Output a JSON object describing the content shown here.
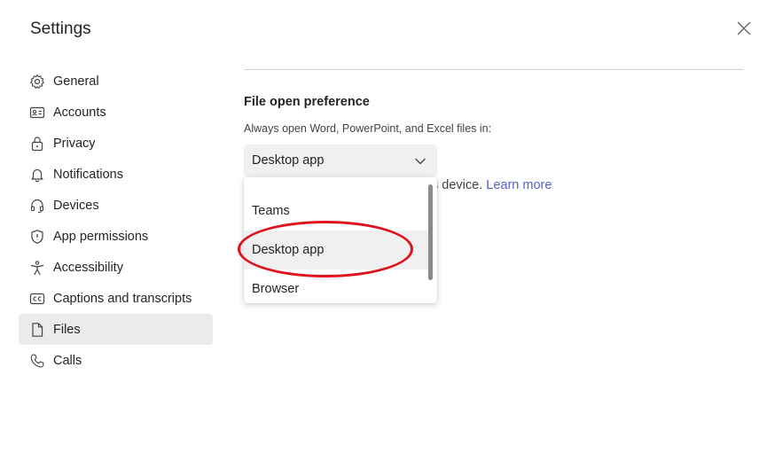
{
  "window": {
    "title": "Settings",
    "close_icon": "close-icon"
  },
  "sidebar": {
    "items": [
      {
        "label": "General",
        "icon": "gear-icon"
      },
      {
        "label": "Accounts",
        "icon": "id-card-icon"
      },
      {
        "label": "Privacy",
        "icon": "lock-icon"
      },
      {
        "label": "Notifications",
        "icon": "bell-icon"
      },
      {
        "label": "Devices",
        "icon": "headset-icon"
      },
      {
        "label": "App permissions",
        "icon": "shield-icon"
      },
      {
        "label": "Accessibility",
        "icon": "accessibility-icon"
      },
      {
        "label": "Captions and transcripts",
        "icon": "cc-icon"
      },
      {
        "label": "Files",
        "icon": "file-icon",
        "active": true
      },
      {
        "label": "Calls",
        "icon": "phone-icon"
      }
    ]
  },
  "files": {
    "section_title": "File open preference",
    "description": "Always open Word, PowerPoint, and Excel files in:",
    "select_value": "Desktop app",
    "hint_visible": "s device.",
    "learn_more": "Learn more",
    "options": [
      "Teams",
      "Desktop app",
      "Browser"
    ],
    "selected_option": "Desktop app"
  },
  "colors": {
    "accent": "#5b5fc7",
    "annotation": "#e0131c",
    "active_bg": "#ebebeb"
  }
}
